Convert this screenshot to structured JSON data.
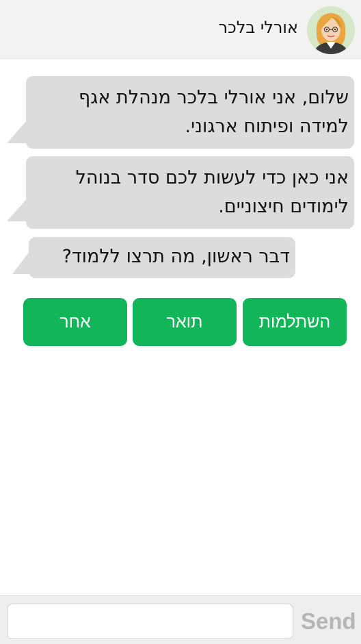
{
  "header": {
    "contact_name": "אורלי בלכר",
    "avatar_icon": "woman-avatar-icon"
  },
  "messages": [
    {
      "lines": [
        "שלום, אני אורלי בלכר מנהלת אגף",
        "למידה ופיתוח ארגוני."
      ]
    },
    {
      "lines": [
        "אני כאן כדי לעשות לכם סדר בנוהל",
        "לימודים חיצוניים."
      ]
    },
    {
      "lines": [
        "דבר ראשון, מה תרצו ללמוד?"
      ]
    }
  ],
  "choices": [
    "השתלמות",
    "תואר",
    "אחר"
  ],
  "composer": {
    "input_value": "",
    "placeholder": "",
    "send_label": "Send"
  },
  "colors": {
    "choice_button": "#12b558",
    "bubble": "#dcdcdc",
    "header_bg": "#f2f2f2",
    "send_text": "#b5b5b5"
  }
}
